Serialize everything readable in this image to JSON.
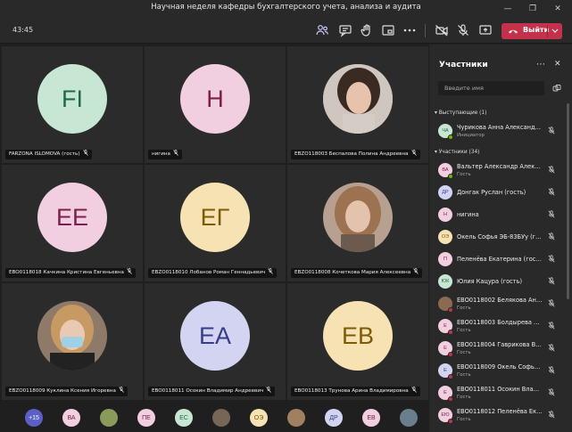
{
  "window": {
    "title": "Научная неделя кафедры бухгалтерского учета, анализа и аудита"
  },
  "toolbar": {
    "timer": "43:45",
    "leave_label": "Выйти"
  },
  "tiles": [
    {
      "initials": "FI",
      "bg": "#c8e6d4",
      "fg": "#1f6b45",
      "name": "FARZONA ISLOMOVA (гость)"
    },
    {
      "initials": "Н",
      "bg": "#f2cfe0",
      "fg": "#7a2049",
      "name": "нигина"
    },
    {
      "photo": "photo-1",
      "name": "EBZO118003 Беспалова Полина Андреевна"
    },
    {
      "initials": "ЕЕ",
      "bg": "#f2cfe0",
      "fg": "#7a2049",
      "name": "EBO0118018 Качкина Кристина Евгеньевна"
    },
    {
      "initials": "ЕГ",
      "bg": "#f6e2b3",
      "fg": "#7c5a07",
      "name": "EBZO0118010 Лобанов Роман Геннадьевич"
    },
    {
      "photo": "photo-2",
      "name": "EBZO0118008 Кочеткова Мария Алексеевна"
    },
    {
      "photo": "photo-3",
      "name": "EBZO0118009 Куклина Ксения Игоревна"
    },
    {
      "initials": "ЕА",
      "bg": "#d2d4f2",
      "fg": "#383c86",
      "name": "EBO0118011 Осокин Владимир Андреевич"
    },
    {
      "initials": "ЕВ",
      "bg": "#f6e2b3",
      "fg": "#7c5a07",
      "name": "EBO0118013 Трунова Арина Владимировна"
    }
  ],
  "bottom_avatars": [
    {
      "text": "+15",
      "bg": "#5b5fc7",
      "fg": "#fff"
    },
    {
      "text": "ВА",
      "bg": "#f2cfe0",
      "fg": "#7a2049"
    },
    {
      "text": "",
      "bg": "#8a9a5b",
      "fg": "#fff",
      "photo": true
    },
    {
      "text": "ПЕ",
      "bg": "#f2cfe0",
      "fg": "#7a2049"
    },
    {
      "text": "ЕС",
      "bg": "#c8e6d4",
      "fg": "#1f6b45"
    },
    {
      "text": "",
      "bg": "#776655",
      "fg": "#fff",
      "photo": true
    },
    {
      "text": "ОЭ",
      "bg": "#f6e2b3",
      "fg": "#7c5a07"
    },
    {
      "text": "",
      "bg": "#a08060",
      "fg": "#fff",
      "photo": true
    },
    {
      "text": "ДР",
      "bg": "#d2d4f2",
      "fg": "#383c86"
    },
    {
      "text": "ЕВ",
      "bg": "#f2cfe0",
      "fg": "#7a2049"
    },
    {
      "text": "",
      "bg": "#6a7e8c",
      "fg": "#fff",
      "photo": true
    }
  ],
  "panel": {
    "title": "Участники",
    "search_placeholder": "Введите имя",
    "presenters_header": "Выступающие (1)",
    "participants_header": "Участники (34)",
    "presenters": [
      {
        "initials": "ЧА",
        "bg": "#c8e6d4",
        "fg": "#1f6b45",
        "name": "Чурикова Анна Александро...",
        "role": "Инициатор",
        "status": "#6bb700"
      }
    ],
    "participants": [
      {
        "initials": "ВА",
        "bg": "#f2cfe0",
        "fg": "#7a2049",
        "name": "Вальтер Александр Алексан...",
        "role": "Гость",
        "status": "#6bb700"
      },
      {
        "initials": "ДР",
        "bg": "#d2d4f2",
        "fg": "#383c86",
        "name": "Донгак Руслан (гость)",
        "role": "",
        "status": ""
      },
      {
        "initials": "Н",
        "bg": "#f2cfe0",
        "fg": "#7a2049",
        "name": "нигина",
        "role": "",
        "status": ""
      },
      {
        "initials": "ОЭ",
        "bg": "#f6e2b3",
        "fg": "#7c5a07",
        "name": "Окель Софья ЭБ-83БУу (гость)",
        "role": "",
        "status": ""
      },
      {
        "initials": "П",
        "bg": "#f2cfe0",
        "fg": "#7a2049",
        "name": "Пеленёва Екатерина (гость)",
        "role": "",
        "status": ""
      },
      {
        "initials": "ЮК",
        "bg": "#c8e6d4",
        "fg": "#1f6b45",
        "name": "Юлия Кацура (гость)",
        "role": "",
        "status": ""
      },
      {
        "initials": "",
        "bg": "#8a6a50",
        "fg": "#fff",
        "name": "EBO0118002 Белякова Ангел...",
        "role": "Гость",
        "status": "#c4314b",
        "photo": true
      },
      {
        "initials": "Е",
        "bg": "#f2cfe0",
        "fg": "#7a2049",
        "name": "EBO0118003 Болдырева Али...",
        "role": "Гость",
        "status": "#c4314b"
      },
      {
        "initials": "Е",
        "bg": "#f2cfe0",
        "fg": "#7a2049",
        "name": "EBO0118004 Гаврикова Вале...",
        "role": "Гость",
        "status": "#c4314b"
      },
      {
        "initials": "Е",
        "bg": "#d2d4f2",
        "fg": "#383c86",
        "name": "EBO0118009 Окель Софья А...",
        "role": "Гость",
        "status": "#c4314b"
      },
      {
        "initials": "Е",
        "bg": "#f2cfe0",
        "fg": "#7a2049",
        "name": "EBO0118011 Осокин Владим...",
        "role": "Гость",
        "status": "#c4314b"
      },
      {
        "initials": "ЕЮ",
        "bg": "#f2cfe0",
        "fg": "#7a2049",
        "name": "EBO0118012 Пеленёва Екат...",
        "role": "Гость",
        "status": "#c4314b"
      }
    ]
  },
  "icons": [
    "people-icon",
    "chat-icon",
    "raise-hand-icon",
    "share-tray-icon",
    "more-icon",
    "camera-off-icon",
    "mic-off-icon",
    "share-screen-icon",
    "phone-icon",
    "chevron-down-icon",
    "mic-off-small-icon"
  ]
}
